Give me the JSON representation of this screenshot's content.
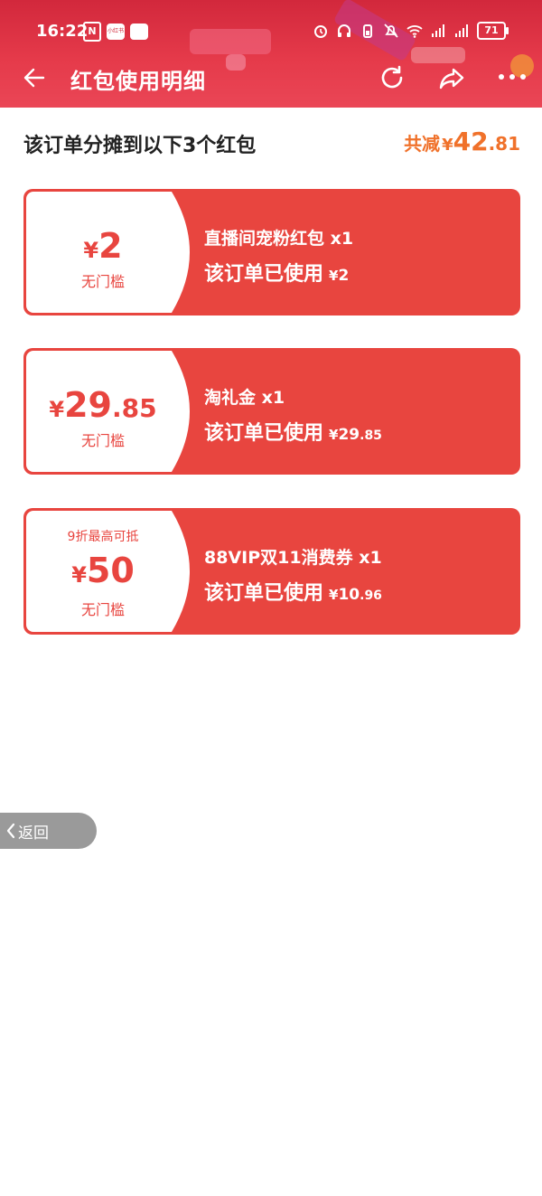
{
  "status_bar": {
    "time": "16:22",
    "nfc": "N",
    "mini_app_label": "小红书",
    "battery": "71"
  },
  "nav": {
    "title": "红包使用明细"
  },
  "summary": {
    "label": "该订单分摊到以下3个红包",
    "total_prefix": "共减",
    "currency": "¥",
    "total_int": "42",
    "total_dec": ".81"
  },
  "cards": [
    {
      "currency": "¥",
      "amount_int": "2",
      "amount_dec": "",
      "condition": "无门槛",
      "cap": "",
      "name": "直播间宠粉红包 x1",
      "used_label": "该订单已使用",
      "used_int": "2",
      "used_dec": ""
    },
    {
      "currency": "¥",
      "amount_int": "29",
      "amount_dec": ".85",
      "condition": "无门槛",
      "cap": "",
      "name": "淘礼金 x1",
      "used_label": "该订单已使用",
      "used_int": "29",
      "used_dec": ".85"
    },
    {
      "currency": "¥",
      "amount_int": "50",
      "amount_dec": "",
      "condition": "无门槛",
      "cap": "9折最高可抵",
      "name": "88VIP双11消费券 x1",
      "used_label": "该订单已使用",
      "used_int": "10",
      "used_dec": ".96"
    }
  ],
  "float_back": {
    "label": "返回"
  },
  "colors": {
    "header": "#e53a4a",
    "card": "#e8453f",
    "total": "#f0712a"
  }
}
